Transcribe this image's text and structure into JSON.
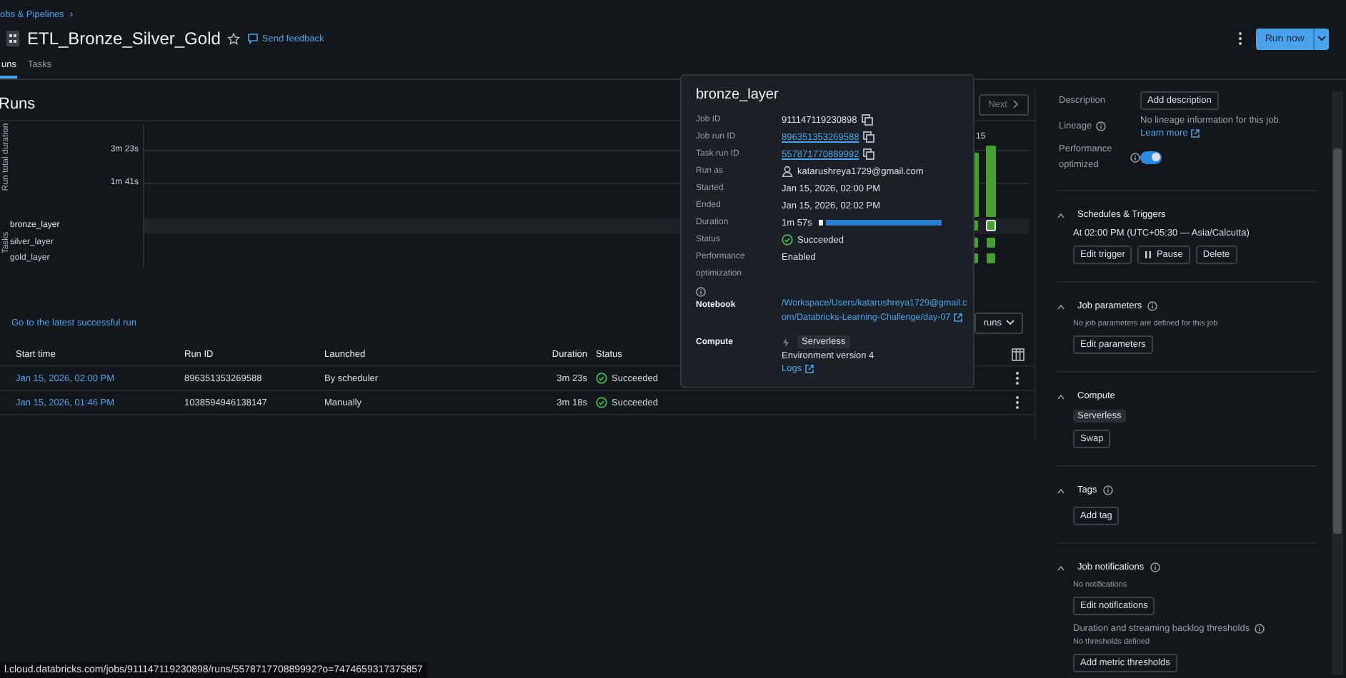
{
  "breadcrumb": {
    "text": "obs & Pipelines",
    "separator": "›"
  },
  "header": {
    "title": "ETL_Bronze_Silver_Gold",
    "favorite": false,
    "feedback": "Send feedback",
    "run_button": "Run now"
  },
  "tabs": [
    {
      "label": "uns",
      "selected": true
    },
    {
      "label": "Tasks",
      "selected": false
    }
  ],
  "runs": {
    "heading": "Runs",
    "next_button": "Next",
    "chart": {
      "axis_title": "Run total duration",
      "tick_labels": [
        "3m 23s",
        "1m 41s"
      ],
      "task_axis_title": "Tasks",
      "column_label": "15",
      "tasks": [
        {
          "name": "bronze_layer",
          "selected": true
        },
        {
          "name": "silver_layer",
          "selected": false
        },
        {
          "name": "gold_layer",
          "selected": false
        }
      ]
    },
    "latest_link": "Go to the latest successful run",
    "filter_button": "runs",
    "table": {
      "columns": [
        "Start time",
        "Run ID",
        "Launched",
        "Duration",
        "Status"
      ],
      "rows": [
        {
          "start": "Jan 15, 2026, 02:00 PM",
          "run_id": "896351353269588",
          "launched": "By scheduler",
          "duration": "3m 23s",
          "status": "Succeeded"
        },
        {
          "start": "Jan 15, 2026, 01:46 PM",
          "run_id": "1038594946138147",
          "launched": "Manually",
          "duration": "3m 18s",
          "status": "Succeeded"
        }
      ]
    }
  },
  "popover": {
    "title": "bronze_layer",
    "fields": [
      {
        "kind": "text",
        "label": "Job ID",
        "value": "911147119230898",
        "copy": true
      },
      {
        "kind": "link",
        "label": "Job run ID",
        "value": "896351353269588",
        "copy": true
      },
      {
        "kind": "link",
        "label": "Task run ID",
        "value": "557871770889992",
        "copy": true
      },
      {
        "kind": "user",
        "label": "Run as",
        "value": "katarushreya1729@gmail.com"
      },
      {
        "kind": "text",
        "label": "Started",
        "value": "Jan 15, 2026, 02:00 PM"
      },
      {
        "kind": "text",
        "label": "Ended",
        "value": "Jan 15, 2026, 02:02 PM"
      },
      {
        "kind": "duration",
        "label": "Duration",
        "value": "1m 57s",
        "level": 0.95
      },
      {
        "kind": "status",
        "label": "Status",
        "value": "Succeeded"
      },
      {
        "kind": "info",
        "label": "Performance optimization",
        "value": "Enabled"
      },
      {
        "kind": "notebook",
        "label": "Notebook",
        "value": "/Workspace/Users/katarushreya1729@gmail.com/Databricks-Learning-Challenge/day-07"
      },
      {
        "kind": "compute",
        "label": "Compute",
        "value": "Serverless",
        "environment": "Environment version 4",
        "logs": "Logs"
      }
    ]
  },
  "side_panel": {
    "description": {
      "label": "Description",
      "button": "Add description"
    },
    "lineage": {
      "label": "Lineage",
      "text": "No lineage information for this job.",
      "link": "Learn more"
    },
    "performance": {
      "label": "Performance optimized",
      "on": true
    },
    "sections": [
      {
        "title": "Schedules & Triggers",
        "info": false,
        "expanded": true,
        "items": [
          {
            "kind": "text",
            "text": "At 02:00 PM (UTC+05:30 — Asia/Calcutta)"
          },
          {
            "kind": "buttons",
            "buttons": [
              {
                "label": "Edit trigger",
                "kind": "plain"
              },
              {
                "label": "Pause",
                "kind": "pause"
              },
              {
                "label": "Delete",
                "kind": "plain"
              }
            ]
          }
        ]
      },
      {
        "title": "Job parameters",
        "info": true,
        "expanded": true,
        "items": [
          {
            "kind": "note",
            "text": "No job parameters are defined for this job"
          },
          {
            "kind": "button",
            "text": "Edit parameters"
          }
        ]
      },
      {
        "title": "Compute",
        "info": false,
        "expanded": true,
        "items": [
          {
            "kind": "chip",
            "text": "Serverless"
          },
          {
            "kind": "button",
            "text": "Swap"
          }
        ]
      },
      {
        "title": "Tags",
        "info": true,
        "expanded": true,
        "items": [
          {
            "kind": "button",
            "text": "Add tag"
          }
        ]
      },
      {
        "title": "Job notifications",
        "info": true,
        "expanded": true,
        "items": [
          {
            "kind": "note",
            "text": "No notifications"
          },
          {
            "kind": "button",
            "text": "Edit notifications"
          },
          {
            "kind": "subheading",
            "text": "Duration and streaming backlog thresholds"
          },
          {
            "kind": "note",
            "text": "No thresholds defined"
          },
          {
            "kind": "button",
            "text": "Add metric thresholds"
          }
        ]
      }
    ]
  },
  "status_url": "l.cloud.databricks.com/jobs/911147119230898/runs/557871770889992?o=7474659317375857"
}
